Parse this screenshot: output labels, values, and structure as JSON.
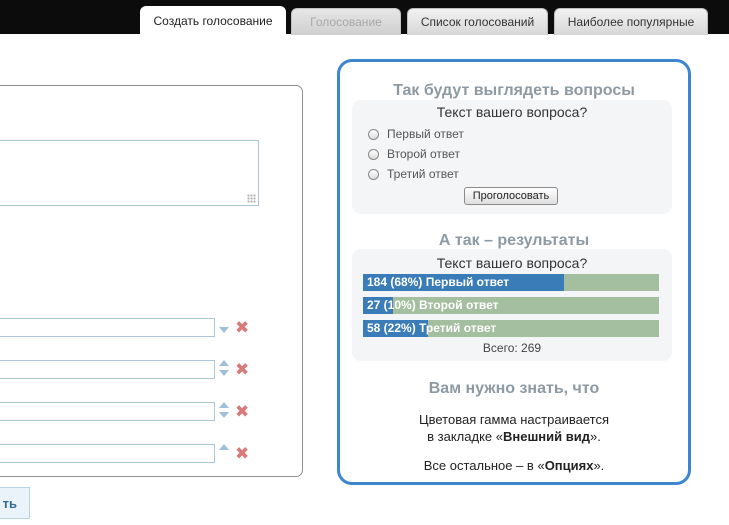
{
  "tabs": [
    {
      "label": "Создать голосование",
      "state": "active"
    },
    {
      "label": "Голосование",
      "state": "disabled"
    },
    {
      "label": "Список голосований",
      "state": "normal"
    },
    {
      "label": "Наиболее популярные",
      "state": "normal"
    }
  ],
  "form": {
    "create_button_label": "ть",
    "answer_rows": [
      {
        "value": "",
        "arrows": "down"
      },
      {
        "value": "",
        "arrows": "both"
      },
      {
        "value": "",
        "arrows": "both"
      },
      {
        "value": "",
        "arrows": "up"
      }
    ]
  },
  "preview": {
    "title": "Так будут выглядеть вопросы",
    "question": "Текст вашего вопроса?",
    "answers": [
      "Первый ответ",
      "Второй ответ",
      "Третий ответ"
    ],
    "vote_button": "Проголосовать",
    "results_title": "А так – результаты",
    "results_question": "Текст вашего вопроса?",
    "results": [
      {
        "label": "184 (68%)  Первый ответ",
        "percent": 68
      },
      {
        "label": "27 (10%)  Второй ответ",
        "percent": 10
      },
      {
        "label": "58 (22%)  Третий ответ",
        "percent": 22
      }
    ],
    "total": "Всего: 269",
    "info_title": "Вам нужно знать, что",
    "info_line1": "Цветовая гамма настраивается",
    "info_line2_pre": "в закладке «",
    "info_line2_bold": "Внешний вид",
    "info_line2_post": "».",
    "info_line3_pre": "Все остальное – в «",
    "info_line3_bold": "Опциях",
    "info_line3_post": "»."
  },
  "colors": {
    "accent_border": "#3c86d0",
    "bar_fill": "#3a7cb8",
    "bar_track": "#a4bf9f",
    "delete_icon": "#d97a7a"
  }
}
